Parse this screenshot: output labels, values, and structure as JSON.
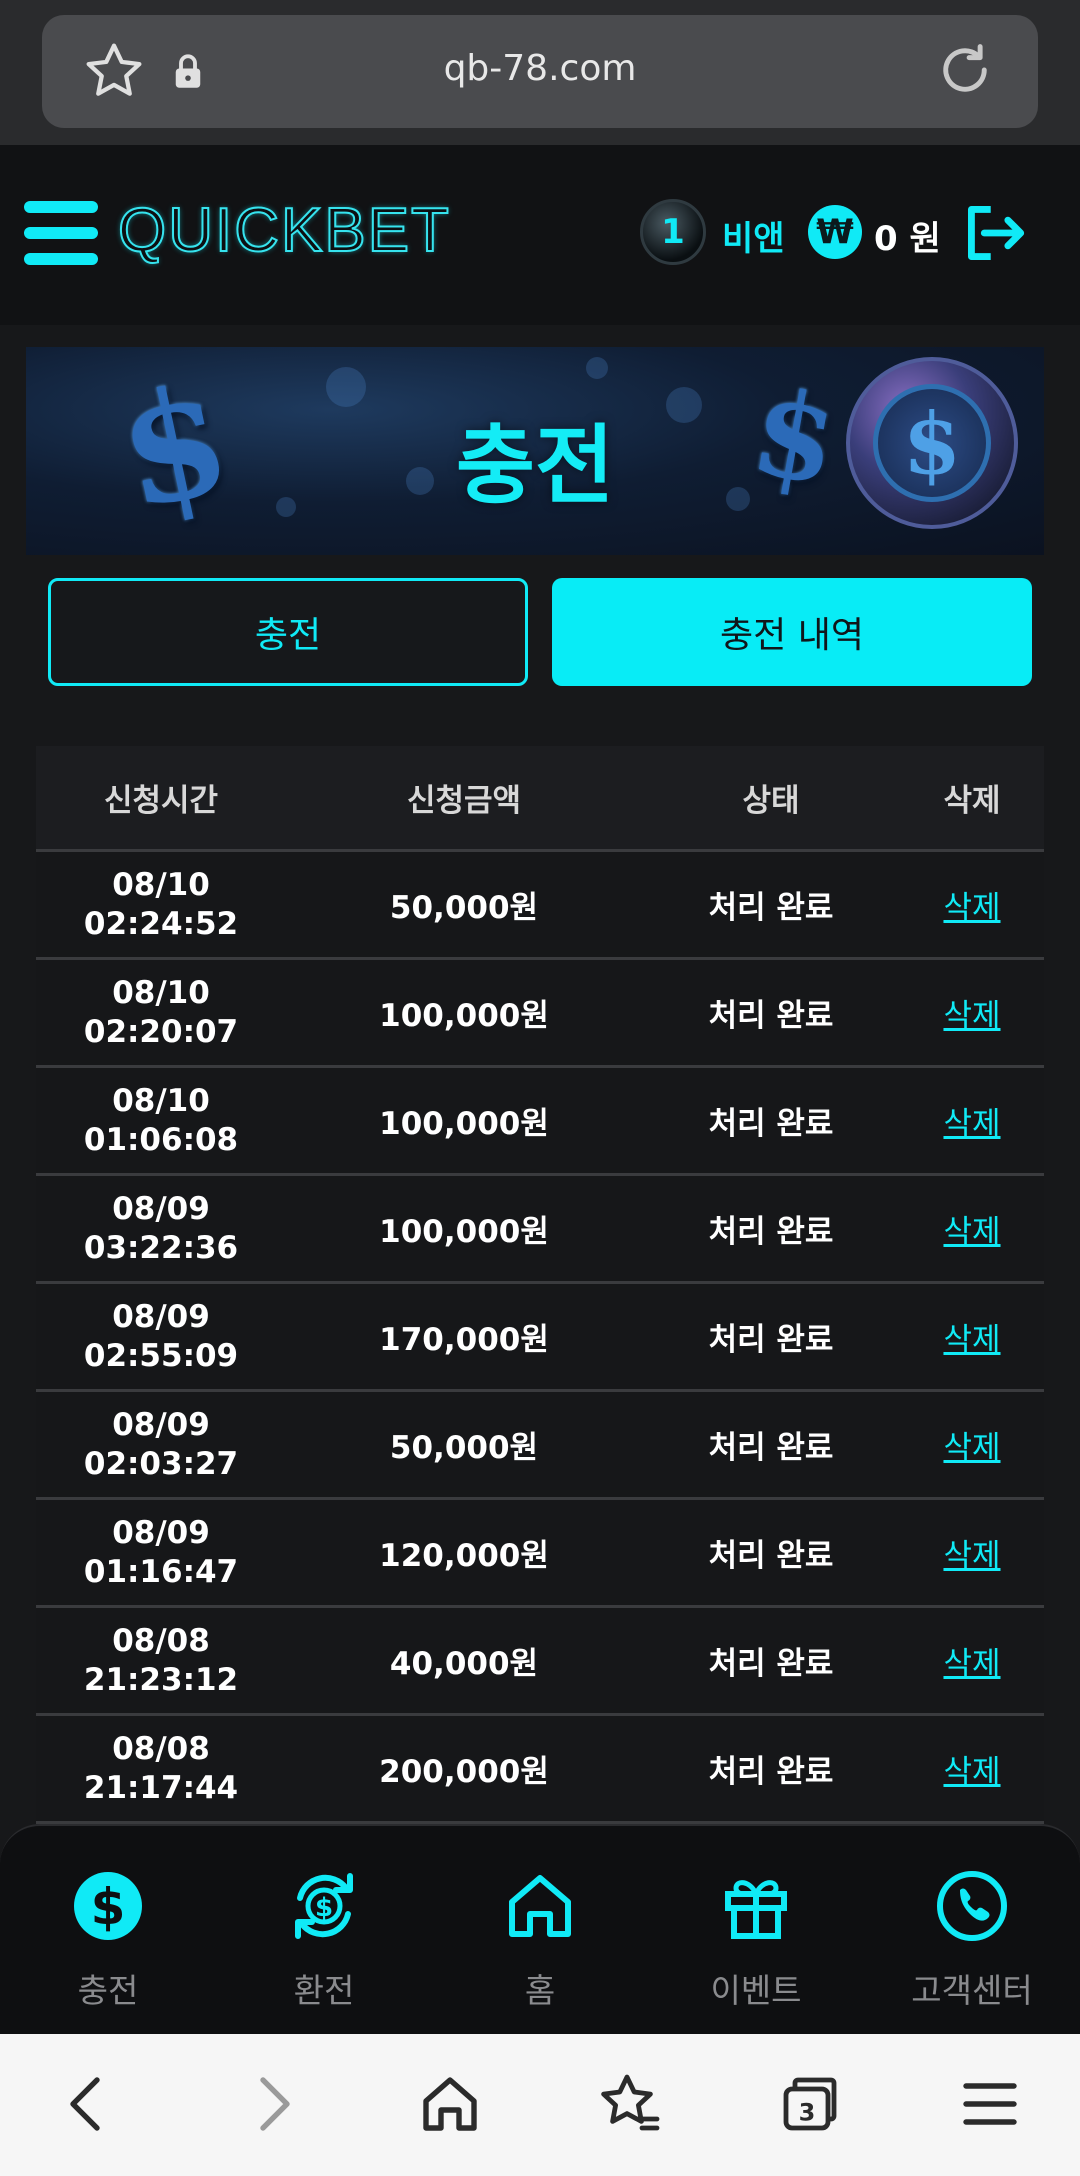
{
  "browser": {
    "url": "qb-78.com",
    "tab_count": "3"
  },
  "header": {
    "logo": "QUICKBET",
    "level": "1",
    "username": "비앤",
    "currency_symbol": "₩",
    "balance": "0 원"
  },
  "banner": {
    "title": "충전"
  },
  "tabs": {
    "deposit": "충전",
    "history": "충전 내역"
  },
  "table": {
    "headers": [
      "신청시간",
      "신청금액",
      "상태",
      "삭제"
    ],
    "rows": [
      {
        "date": "08/10",
        "time": "02:24:52",
        "amount": "50,000원",
        "status": "처리 완료",
        "delete": "삭제"
      },
      {
        "date": "08/10",
        "time": "02:20:07",
        "amount": "100,000원",
        "status": "처리 완료",
        "delete": "삭제"
      },
      {
        "date": "08/10",
        "time": "01:06:08",
        "amount": "100,000원",
        "status": "처리 완료",
        "delete": "삭제"
      },
      {
        "date": "08/09",
        "time": "03:22:36",
        "amount": "100,000원",
        "status": "처리 완료",
        "delete": "삭제"
      },
      {
        "date": "08/09",
        "time": "02:55:09",
        "amount": "170,000원",
        "status": "처리 완료",
        "delete": "삭제"
      },
      {
        "date": "08/09",
        "time": "02:03:27",
        "amount": "50,000원",
        "status": "처리 완료",
        "delete": "삭제"
      },
      {
        "date": "08/09",
        "time": "01:16:47",
        "amount": "120,000원",
        "status": "처리 완료",
        "delete": "삭제"
      },
      {
        "date": "08/08",
        "time": "21:23:12",
        "amount": "40,000원",
        "status": "처리 완료",
        "delete": "삭제"
      },
      {
        "date": "08/08",
        "time": "21:17:44",
        "amount": "200,000원",
        "status": "처리 완료",
        "delete": "삭제"
      }
    ]
  },
  "bottom_nav": [
    {
      "label": "충전",
      "icon": "dollar-coin-icon"
    },
    {
      "label": "환전",
      "icon": "exchange-icon"
    },
    {
      "label": "홈",
      "icon": "home-icon"
    },
    {
      "label": "이벤트",
      "icon": "gift-icon"
    },
    {
      "label": "고객센터",
      "icon": "phone-icon"
    }
  ],
  "colors": {
    "accent": "#10eaf6",
    "background": "#17181a"
  }
}
